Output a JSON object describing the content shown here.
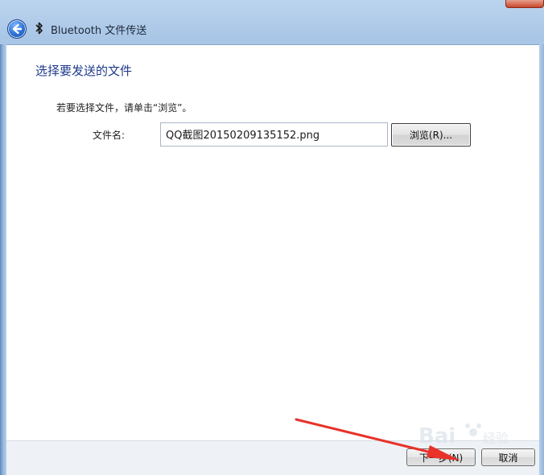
{
  "window": {
    "title": "Bluetooth 文件传送",
    "back_icon": "back-arrow-icon",
    "bluetooth_icon": "bluetooth-icon",
    "close_color": "#c8472a"
  },
  "main": {
    "heading": "选择要发送的文件",
    "instruction": "若要选择文件，请单击“浏览”。",
    "file_label": "文件名:",
    "file_value": "QQ截图20150209135152.png",
    "browse_label": "浏览(R)..."
  },
  "footer": {
    "next_label": "下一步(N)",
    "cancel_label": "取消"
  },
  "overlay": {
    "arrow_color": "#e8322a"
  }
}
